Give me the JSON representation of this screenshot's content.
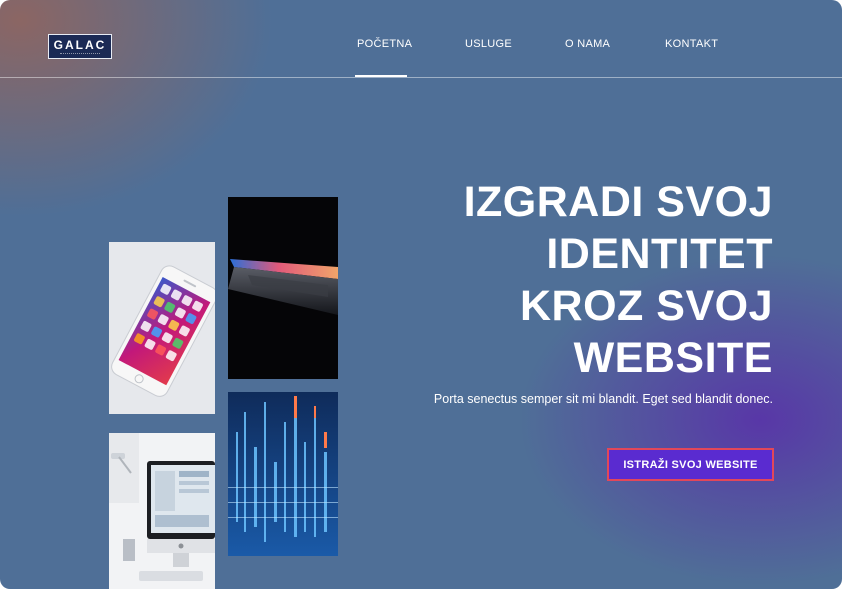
{
  "logo": {
    "text": "GALAC"
  },
  "nav": {
    "items": [
      {
        "label": "POČETNA",
        "active": true
      },
      {
        "label": "USLUGE",
        "active": false
      },
      {
        "label": "O NAMA",
        "active": false
      },
      {
        "label": "KONTAKT",
        "active": false
      }
    ]
  },
  "hero": {
    "headline_lines": [
      "IZGRADI SVOJ",
      "IDENTITET",
      "KROZ SVOJ",
      "WEBSITE"
    ],
    "subtext": "Porta senectus semper sit mi blandit. Eget sed blandit donec.",
    "cta_label": "ISTRAŽI SVOJ WEBSITE"
  },
  "colors": {
    "background": "#4f6f97",
    "accent_purple": "#5a2bd0",
    "cta_border": "#e2475a",
    "logo_bg": "#1b2a55"
  },
  "images": {
    "phone": "smartphone-photo",
    "laptop": "laptop-photo",
    "desk": "desktop-computer-photo",
    "data": "data-visualization-photo"
  }
}
